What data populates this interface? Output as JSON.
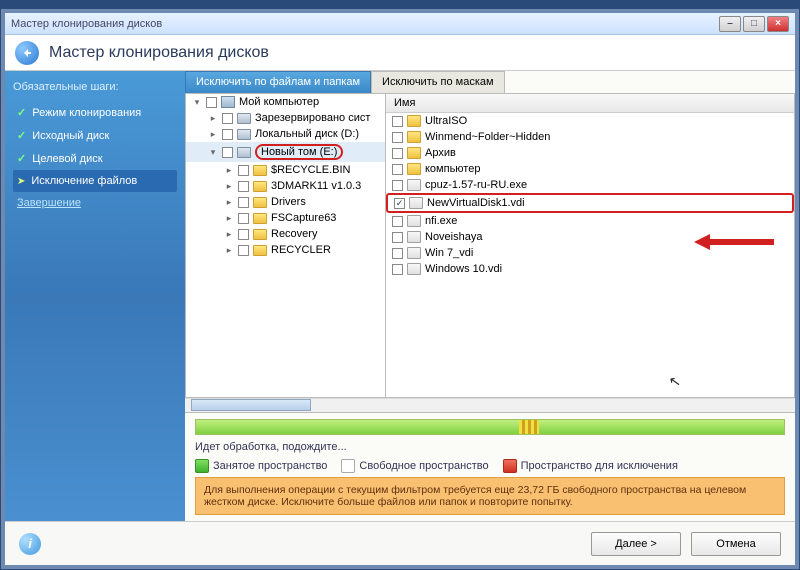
{
  "titlebar": {
    "title": "Мастер клонирования дисков"
  },
  "header": {
    "title": "Мастер клонирования дисков"
  },
  "sidebar": {
    "heading": "Обязательные шаги:",
    "items": [
      {
        "label": "Режим клонирования",
        "state": "done"
      },
      {
        "label": "Исходный диск",
        "state": "done"
      },
      {
        "label": "Целевой диск",
        "state": "done"
      },
      {
        "label": "Исключение файлов",
        "state": "current"
      },
      {
        "label": "Завершение",
        "state": "future"
      }
    ]
  },
  "tabs": {
    "active": "Исключить по файлам и папкам",
    "other": "Исключить по маскам"
  },
  "tree": [
    {
      "indent": 0,
      "label": "Мой компьютер",
      "icon": "comp",
      "exp": "▾"
    },
    {
      "indent": 1,
      "label": "Зарезервировано сист",
      "icon": "drive",
      "exp": "▸"
    },
    {
      "indent": 1,
      "label": "Локальный диск (D:)",
      "icon": "drive",
      "exp": "▸"
    },
    {
      "indent": 1,
      "label": "Новый том (E:)",
      "icon": "drive",
      "exp": "▾",
      "highlight": true
    },
    {
      "indent": 2,
      "label": "$RECYCLE.BIN",
      "icon": "folder",
      "exp": "▸"
    },
    {
      "indent": 2,
      "label": "3DMARK11 v1.0.3",
      "icon": "folder",
      "exp": "▸"
    },
    {
      "indent": 2,
      "label": "Drivers",
      "icon": "folder",
      "exp": "▸"
    },
    {
      "indent": 2,
      "label": "FSCapture63",
      "icon": "folder",
      "exp": "▸"
    },
    {
      "indent": 2,
      "label": "Recovery",
      "icon": "folder",
      "exp": "▸"
    },
    {
      "indent": 2,
      "label": "RECYCLER",
      "icon": "folder",
      "exp": "▸"
    }
  ],
  "filelist": {
    "header": "Имя",
    "rows": [
      {
        "label": "UltraISO",
        "icon": "folder",
        "checked": false
      },
      {
        "label": "Winmend~Folder~Hidden",
        "icon": "folder",
        "checked": false
      },
      {
        "label": "Архив",
        "icon": "folder",
        "checked": false
      },
      {
        "label": "компьютер",
        "icon": "folder",
        "checked": false
      },
      {
        "label": "cpuz-1.57-ru-RU.exe",
        "icon": "file",
        "checked": false
      },
      {
        "label": "NewVirtualDisk1.vdi",
        "icon": "file",
        "checked": true,
        "selected": true
      },
      {
        "label": "nfi.exe",
        "icon": "file",
        "checked": false
      },
      {
        "label": "Noveishaya",
        "icon": "file",
        "checked": false
      },
      {
        "label": "Win 7_vdi",
        "icon": "file",
        "checked": false
      },
      {
        "label": "Windows 10.vdi",
        "icon": "file",
        "checked": false
      }
    ]
  },
  "status": {
    "text": "Идет обработка, подождите..."
  },
  "legend": {
    "used": "Занятое пространство",
    "free": "Свободное пространство",
    "excl": "Пространство для исключения"
  },
  "warning": "Для выполнения операции с текущим фильтром требуется еще 23,72 ГБ свободного пространства на целевом жестком диске. Исключите больше файлов или папок и повторите попытку.",
  "footer": {
    "next": "Далее >",
    "cancel": "Отмена"
  },
  "progress": {
    "mark_left_pct": 55
  }
}
